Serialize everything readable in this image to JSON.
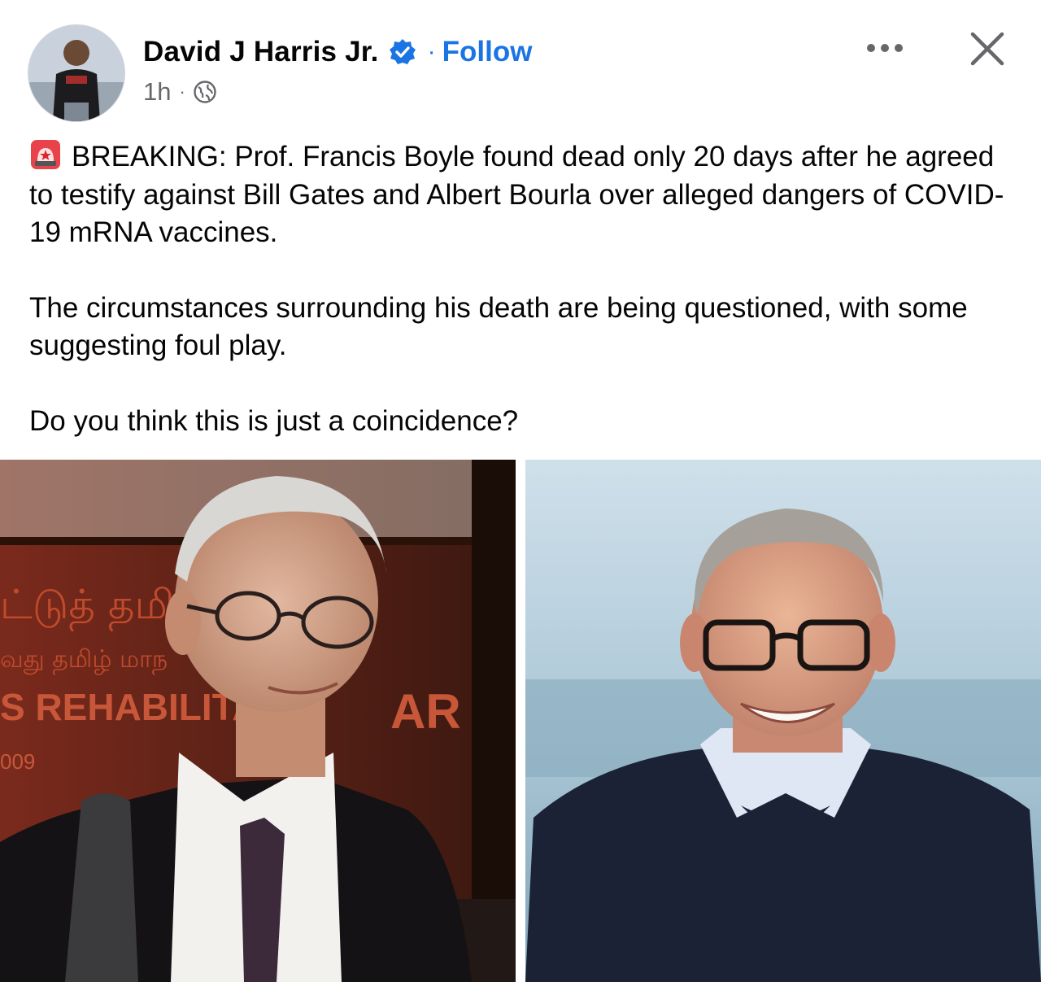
{
  "post": {
    "author": "David J Harris Jr.",
    "separator": "·",
    "follow_label": "Follow",
    "timestamp": "1h",
    "meta_separator": "·",
    "audience_icon": "globe-icon",
    "verified_icon": "verified-badge-icon",
    "more_icon": "more-options-icon",
    "close_icon": "close-icon",
    "paragraphs": {
      "p1_icon": "police-siren-emoji",
      "p1": "BREAKING: Prof. Francis Boyle found dead only 20 days after he agreed to testify against Bill Gates and Albert Bourla over alleged dangers of COVID-19 mRNA vaccines.",
      "p2": "The circumstances surrounding his death are being questioned, with some suggesting foul play.",
      "p3": "Do you think this is just a coincidence?"
    },
    "images": {
      "left_banner_text_1": "ட்டுத் தமி",
      "left_banner_text_2": "வது தமிழ் மாந",
      "left_banner_text_3": "S REHABILITATIO",
      "left_banner_text_4": "AR",
      "left_banner_text_5": "009"
    }
  },
  "colors": {
    "link_blue": "#1b74e4",
    "text_primary": "#050505",
    "text_secondary": "#65676b"
  }
}
